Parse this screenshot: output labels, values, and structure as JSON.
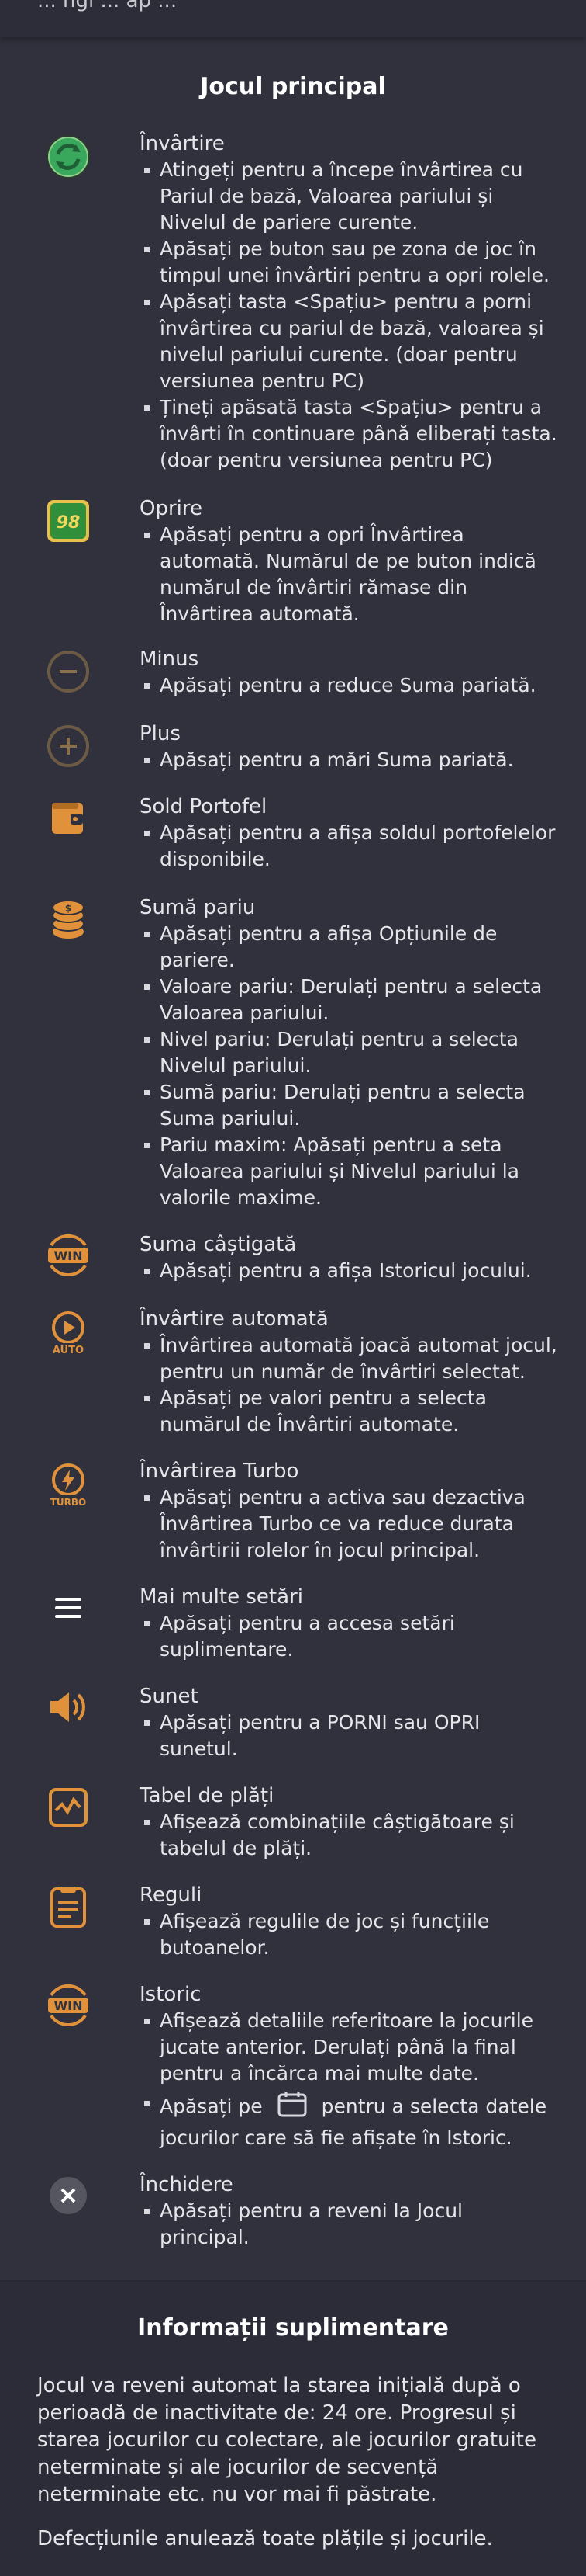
{
  "top_partial_text": "... ngi ... ap ...",
  "main_section": {
    "title": "Jocul principal",
    "items": [
      {
        "icon": "spin-icon",
        "title": "Învârtire",
        "points": [
          "Atingeți pentru a începe învârtirea cu Pariul de bază, Valoarea pariului și Nivelul de pariere curente.",
          "Apăsați pe buton sau pe zona de joc în timpul unei învârtiri pentru a opri rolele.",
          "Apăsați tasta <Spațiu> pentru a porni învârtirea cu pariul de bază, valoarea și nivelul pariului curente. (doar pentru versiunea pentru PC)",
          "Țineți apăsată tasta <Spațiu> pentru a învârti în continuare până eliberați tasta. (doar pentru versiunea pentru PC)"
        ]
      },
      {
        "icon": "stop-autospin-icon",
        "icon_text": "98",
        "title": "Oprire",
        "points": [
          "Apăsați pentru a opri Învârtirea automată. Numărul de pe buton indică numărul de învârtiri rămase din Învârtirea automată."
        ]
      },
      {
        "icon": "minus-icon",
        "title": "Minus",
        "points": [
          "Apăsați pentru a reduce Suma pariată."
        ]
      },
      {
        "icon": "plus-icon",
        "title": "Plus",
        "points": [
          "Apăsați pentru a mări Suma pariată."
        ]
      },
      {
        "icon": "wallet-icon",
        "title": "Sold Portofel",
        "points": [
          "Apăsați pentru a afișa soldul portofelelor disponibile."
        ]
      },
      {
        "icon": "coins-icon",
        "title": "Sumă pariu",
        "points": [
          "Apăsați pentru a afișa Opțiunile de pariere.",
          "Valoare pariu: Derulați pentru a selecta Valoarea pariului.",
          "Nivel pariu: Derulați pentru a selecta Nivelul pariului.",
          "Sumă pariu: Derulați pentru a selecta Suma pariului.",
          "Pariu maxim: Apăsați pentru a seta Valoarea pariului și Nivelul pariului la valorile maxime."
        ]
      },
      {
        "icon": "win-icon",
        "icon_text": "WIN",
        "title": "Suma câștigată",
        "points": [
          "Apăsați pentru a afișa Istoricul jocului."
        ]
      },
      {
        "icon": "autospin-icon",
        "icon_text": "AUTO",
        "title": "Învârtire automată",
        "points": [
          "Învârtirea automată joacă automat jocul, pentru un număr de învârtiri selectat.",
          "Apăsați pe valori pentru a selecta numărul de Învârtiri automate."
        ]
      },
      {
        "icon": "turbo-icon",
        "icon_text": "TURBO",
        "title": "Învârtirea Turbo",
        "points": [
          "Apăsați pentru a activa sau dezactiva Învârtirea Turbo ce va reduce durata învârtirii rolelor în jocul principal."
        ]
      },
      {
        "icon": "menu-icon",
        "title": "Mai multe setări",
        "points": [
          "Apăsați pentru a accesa setări suplimentare."
        ]
      },
      {
        "icon": "sound-icon",
        "title": "Sunet",
        "points": [
          "Apăsați pentru a PORNI sau OPRI sunetul."
        ]
      },
      {
        "icon": "paytable-icon",
        "title": "Tabel de plăți",
        "points": [
          "Afișează combinațiile câștigătoare și tabelul de plăți."
        ]
      },
      {
        "icon": "rules-icon",
        "title": "Reguli",
        "points": [
          "Afișează regulile de joc și funcțiile butoanelor."
        ]
      },
      {
        "icon": "history-icon",
        "icon_text": "WIN",
        "title": "Istoric",
        "points": [
          "Afișează detaliile referitoare la jocurile jucate anterior. Derulați până la final pentru a încărca mai multe date."
        ],
        "calendar_point": {
          "before": "Apăsați pe",
          "after": "pentru a selecta datele",
          "continuation": "jocurilor care să fie afișate în Istoric."
        }
      },
      {
        "icon": "close-icon",
        "title": "Închidere",
        "points": [
          "Apăsați pentru a reveni la Jocul principal."
        ]
      }
    ]
  },
  "extra_section": {
    "title": "Informații suplimentare",
    "paragraphs": [
      "Jocul va reveni automat la starea inițială după o perioadă de inactivitate de: 24 ore. Progresul și starea jocurilor cu colectare, ale jocurilor gratuite neterminate și ale jocurilor de secvență neterminate etc. nu vor mai fi păstrate.",
      "Defecțiunile anulează toate plățile și jocurile."
    ]
  },
  "colors": {
    "background": "#30313d",
    "accent_orange": "#e0913a",
    "spin_green": "#3aa85c",
    "stop_green": "#2f8f3a",
    "text": "#e6e6ea"
  }
}
